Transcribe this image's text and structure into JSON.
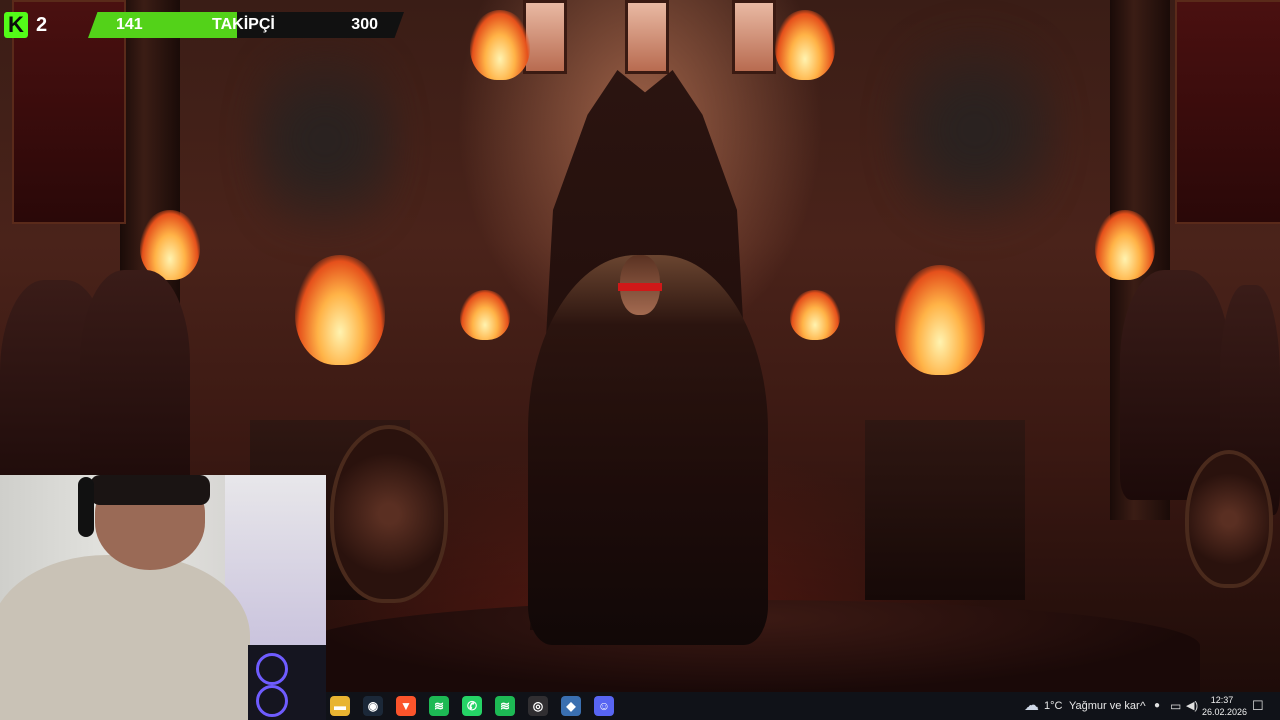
{
  "stream_overlay": {
    "platform_badge": "K",
    "badge_count": "2",
    "follower_goal": {
      "current": "141",
      "title": "TAKİPÇİ",
      "goal": "300",
      "progress_fraction": 0.47,
      "fill_color": "#53d219"
    },
    "brand_color": "#53fc18"
  },
  "taskbar": {
    "icons": [
      {
        "name": "file-explorer-icon",
        "glyph": "▬",
        "color": "#e8b431"
      },
      {
        "name": "steam-icon",
        "glyph": "◉",
        "color": "#1b2838"
      },
      {
        "name": "brave-icon",
        "glyph": "▼",
        "color": "#fb542b"
      },
      {
        "name": "spotify-icon",
        "glyph": "≋",
        "color": "#1db954"
      },
      {
        "name": "whatsapp-icon",
        "glyph": "✆",
        "color": "#25d366"
      },
      {
        "name": "spotify-icon",
        "glyph": "≋",
        "color": "#1db954"
      },
      {
        "name": "obs-icon",
        "glyph": "◎",
        "color": "#302e31"
      },
      {
        "name": "app-icon",
        "glyph": "◆",
        "color": "#3a6fb0"
      },
      {
        "name": "discord-icon",
        "glyph": "☺",
        "color": "#5865f2"
      }
    ],
    "weather": {
      "icon": "cloud-snow-icon",
      "temperature": "1°C",
      "condition": "Yağmur ve kar"
    },
    "tray": {
      "chevron": "^",
      "mic": "🎙",
      "network": "▭",
      "volume": "🔊"
    },
    "clock": {
      "time": "12:37",
      "date": "26.02.2026"
    },
    "notification_icon": "☐"
  }
}
